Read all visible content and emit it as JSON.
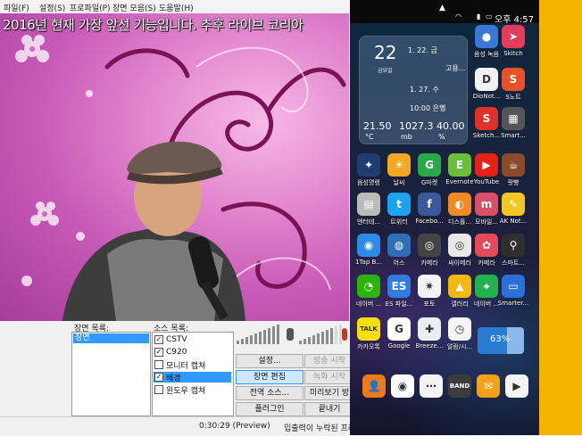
{
  "menu": [
    "파일(F)",
    "설정(S)",
    "프로파일(P)",
    "장면 모음(S)",
    "도움말(H)"
  ],
  "preview": {
    "ticker": "2016년 현재 가장 앞선 기능입니다. 추후 라이브 코리아"
  },
  "scenes": {
    "label": "장면 목록:",
    "items": [
      "장면"
    ]
  },
  "sources": {
    "label": "소스 목록:",
    "items": [
      {
        "name": "CSTV",
        "checked": true
      },
      {
        "name": "C920",
        "checked": true
      },
      {
        "name": "모니터 캡쳐",
        "checked": false
      },
      {
        "name": "배경",
        "checked": true
      },
      {
        "name": "윈도우 캡쳐",
        "checked": false
      }
    ]
  },
  "buttons": {
    "settings": "설정...",
    "start_stream": "방송 시작",
    "edit_scene": "장면 편집",
    "start_record": "녹화 시작",
    "global_sources": "전역 소스...",
    "preview_stream": "미리보기 방",
    "plugins": "플러그인",
    "exit": "끝내기"
  },
  "status": {
    "time": "0:30:29 (Preview)",
    "message": "입출력이 누락된 프레"
  },
  "phone": {
    "status_time": "오후 4:57",
    "widget": {
      "date_num": "22",
      "date_sub": "금요일",
      "event1": "1. 22. 금",
      "event1b": "고용...",
      "event2": "1. 27. 수",
      "event3": "10:00 은행",
      "rate1": "21.50",
      "rate1u": "°C",
      "rate2": "1027.3",
      "rate2u": "mb",
      "rate3": "40.00",
      "rate3u": "%"
    },
    "apps": [
      {
        "label": "음성 녹음",
        "color": "#3a78d8",
        "glyph": "●"
      },
      {
        "label": "Skitch",
        "color": "#e23d5b",
        "glyph": "➤"
      },
      {
        "label": "DioNot...",
        "color": "#f2f2f2",
        "glyph": "D",
        "dark": true
      },
      {
        "label": "S노트",
        "color": "#e8502a",
        "glyph": "S"
      },
      {
        "label": "Sketch...",
        "color": "#e0302a",
        "glyph": "S"
      },
      {
        "label": "Smart...",
        "color": "#555555",
        "glyph": "▦"
      },
      {
        "label": "음성명령",
        "color": "#1f3c73",
        "glyph": "✦"
      },
      {
        "label": "날씨",
        "color": "#f5a623",
        "glyph": "☀"
      },
      {
        "label": "G마켓",
        "color": "#2aa84a",
        "glyph": "G"
      },
      {
        "label": "Evernote",
        "color": "#6bbf3b",
        "glyph": "E"
      },
      {
        "label": "YouTube",
        "color": "#e62117",
        "glyph": "▶"
      },
      {
        "label": "팟빵",
        "color": "#8a4b2a",
        "glyph": "☕"
      },
      {
        "label": "엔터테...",
        "color": "#bbbbbb",
        "glyph": "▤"
      },
      {
        "label": "트위터",
        "color": "#1da1f2",
        "glyph": "t"
      },
      {
        "label": "Facebo...",
        "color": "#3b5998",
        "glyph": "f"
      },
      {
        "label": "디스플...",
        "color": "#f08a24",
        "glyph": "◐"
      },
      {
        "label": "모바일...",
        "color": "#d94f6a",
        "glyph": "m"
      },
      {
        "label": "AK Not...",
        "color": "#f3c623",
        "glyph": "✎"
      },
      {
        "label": "1Tap B...",
        "color": "#2b8be6",
        "glyph": "◉"
      },
      {
        "label": "어스",
        "color": "#2f6fb7",
        "glyph": "◍"
      },
      {
        "label": "카메라",
        "color": "#444444",
        "glyph": "◎"
      },
      {
        "label": "싸이메라",
        "color": "#e8e8e8",
        "glyph": "◎",
        "dark": true
      },
      {
        "label": "카메라",
        "color": "#e44a5a",
        "glyph": "✿"
      },
      {
        "label": "스마트...",
        "color": "#2f2f2f",
        "glyph": "⚲"
      },
      {
        "label": "네이버 ...",
        "color": "#2db400",
        "glyph": "◔"
      },
      {
        "label": "ES 파일...",
        "color": "#2f7de1",
        "glyph": "ES"
      },
      {
        "label": "포토",
        "color": "#f4f4f4",
        "glyph": "✷",
        "dark": true
      },
      {
        "label": "갤러리",
        "color": "#f2b90e",
        "glyph": "▲"
      },
      {
        "label": "네이버 ...",
        "color": "#22b14c",
        "glyph": "⌖"
      },
      {
        "label": "Smarter...",
        "color": "#2c6fd6",
        "glyph": "▭"
      },
      {
        "label": "카카오톡",
        "color": "#f9e000",
        "glyph": "TALK",
        "dark": true
      },
      {
        "label": "Google",
        "color": "#ffffff",
        "glyph": "G",
        "dark": true
      },
      {
        "label": "Breeze...",
        "color": "#e8eef2",
        "glyph": "✚",
        "dark": true
      },
      {
        "label": "알람/시...",
        "color": "#f5f5f5",
        "glyph": "◷",
        "dark": true
      }
    ],
    "battery": "63%",
    "dock": [
      {
        "label": "contacts",
        "color": "#f07a1a",
        "glyph": "👤"
      },
      {
        "label": "chrome",
        "color": "#ffffff",
        "glyph": "◉",
        "dark": true
      },
      {
        "label": "apps",
        "color": "#f4f4f4",
        "glyph": "⋯",
        "dark": true
      },
      {
        "label": "band",
        "color": "#3c3c3c",
        "glyph": "BAND"
      },
      {
        "label": "email",
        "color": "#f6a01a",
        "glyph": "✉"
      },
      {
        "label": "store",
        "color": "#f4f4f4",
        "glyph": "▶",
        "dark": true
      }
    ]
  }
}
